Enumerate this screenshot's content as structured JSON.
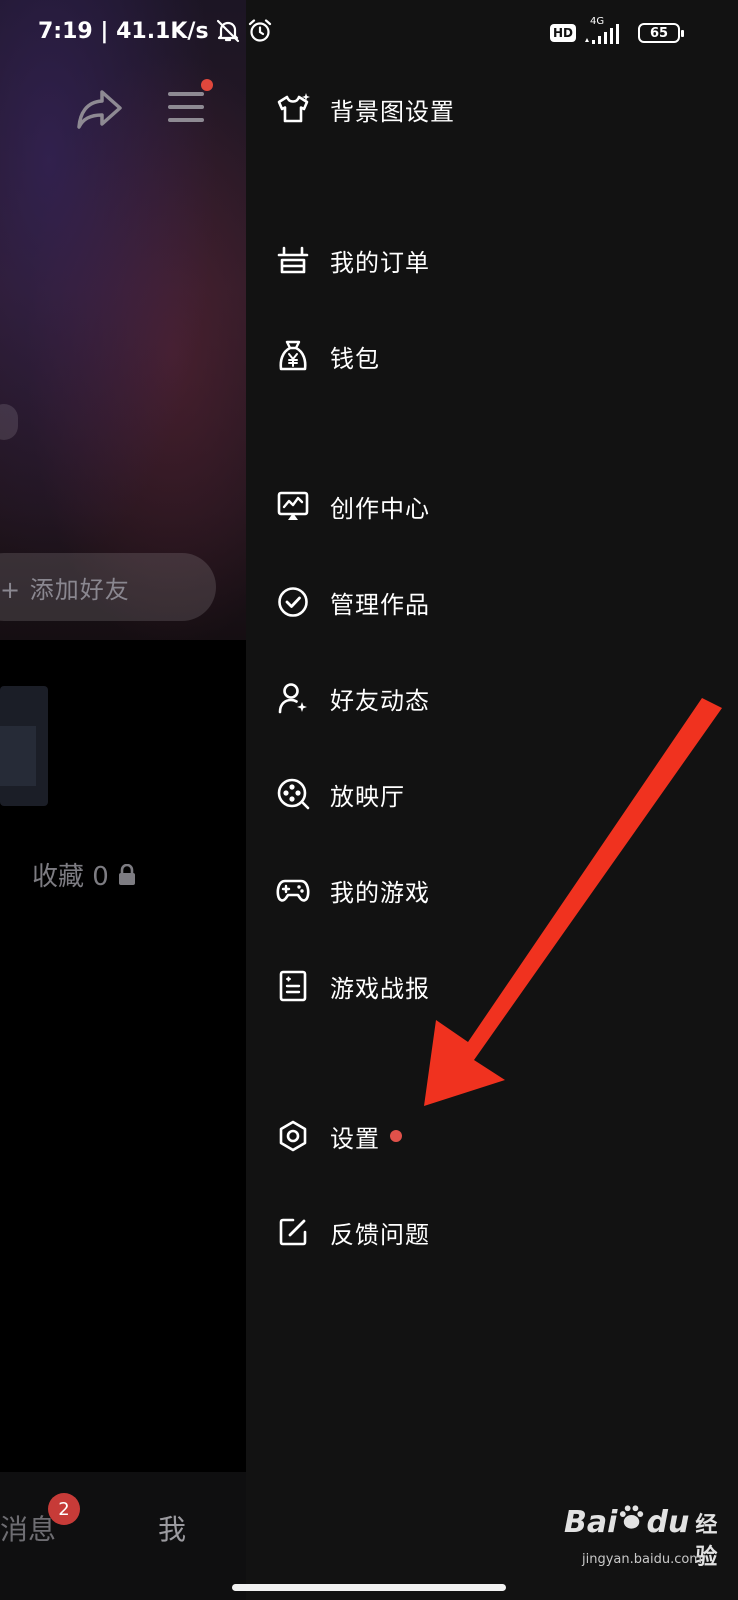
{
  "status_bar": {
    "time_speed": "7:19 | 41.1K/s",
    "hd": "HD",
    "network": "4G",
    "battery": "65"
  },
  "left_page": {
    "add_friend": "+ 添加好友",
    "favorites": "收藏 0",
    "tabs": {
      "messages": "消息",
      "messages_badge": "2",
      "me": "我"
    }
  },
  "drawer": {
    "items": [
      {
        "label": "背景图设置",
        "icon": "tshirt-icon"
      },
      {
        "label": "我的订单",
        "icon": "order-icon"
      },
      {
        "label": "钱包",
        "icon": "wallet-icon"
      },
      {
        "label": "创作中心",
        "icon": "creator-center-icon"
      },
      {
        "label": "管理作品",
        "icon": "check-circle-icon"
      },
      {
        "label": "好友动态",
        "icon": "friend-activity-icon"
      },
      {
        "label": "放映厅",
        "icon": "film-reel-icon"
      },
      {
        "label": "我的游戏",
        "icon": "gamepad-icon"
      },
      {
        "label": "游戏战报",
        "icon": "game-report-icon"
      },
      {
        "label": "设置",
        "icon": "hexagon-settings-icon"
      },
      {
        "label": "反馈问题",
        "icon": "feedback-icon"
      }
    ]
  },
  "watermark": {
    "bai": "Bai",
    "du": "du",
    "jingyan": "经验",
    "url": "jingyan.baidu.com"
  },
  "colors": {
    "drawer_bg": "#121212",
    "accent_red": "#e0473c",
    "arrow_red": "#f0321f"
  }
}
